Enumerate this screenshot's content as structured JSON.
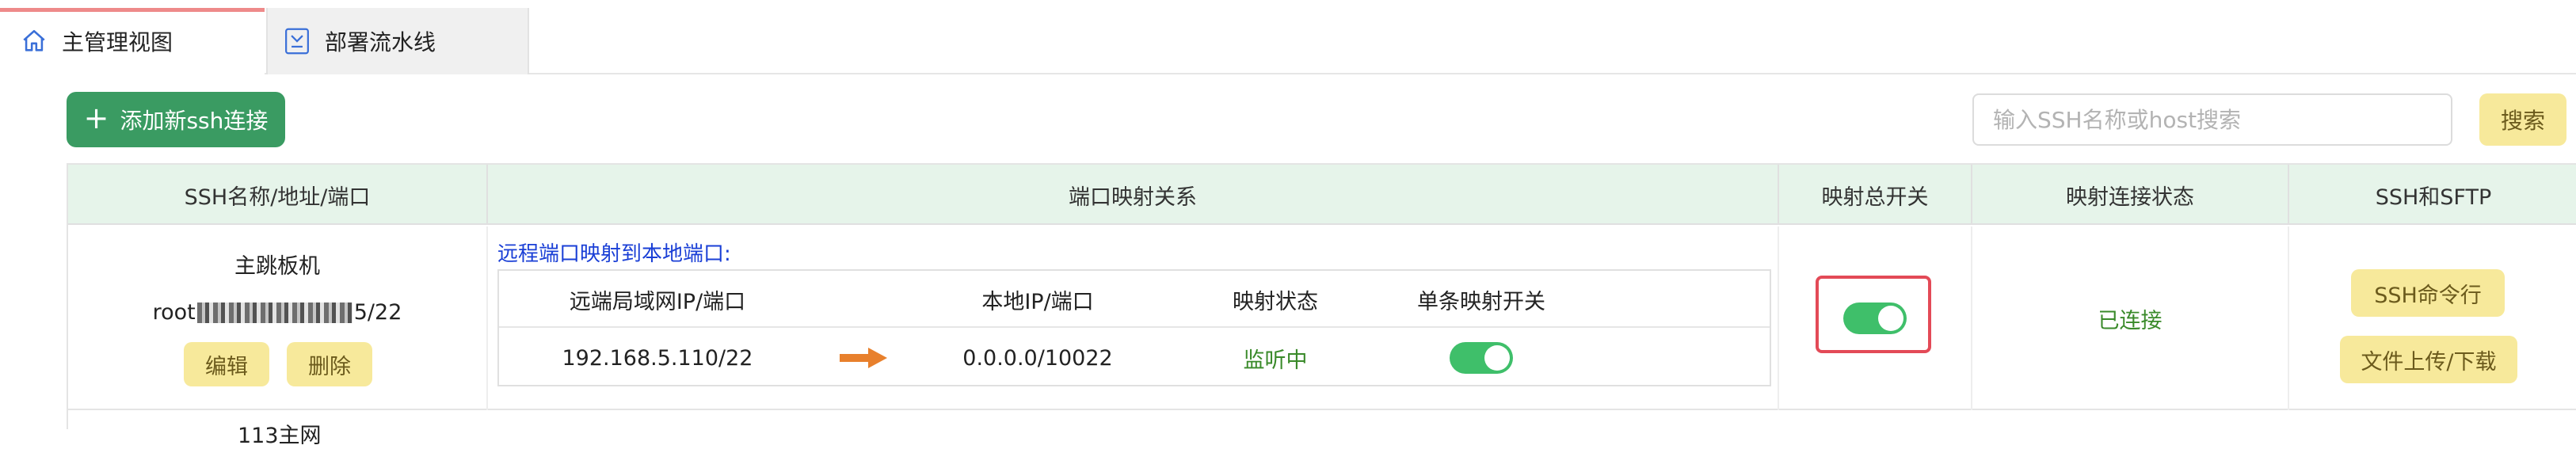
{
  "tabs": [
    {
      "label": "主管理视图",
      "icon": "home-icon",
      "active": true
    },
    {
      "label": "部署流水线",
      "icon": "pipeline-icon",
      "active": false
    }
  ],
  "toolbar": {
    "add_label": "添加新ssh连接",
    "search_placeholder": "输入SSH名称或host搜索",
    "search_label": "搜索"
  },
  "table": {
    "headers": [
      "SSH名称/地址/端口",
      "端口映射关系",
      "映射总开关",
      "映射连接状态",
      "SSH和SFTP"
    ],
    "rows": [
      {
        "name": "主跳板机",
        "addr_prefix": "root",
        "addr_suffix": "5/22",
        "edit_label": "编辑",
        "delete_label": "删除",
        "mapping_title": "远程端口映射到本地端口:",
        "mapping_headers": [
          "远端局域网IP/端口",
          "本地IP/端口",
          "映射状态",
          "单条映射开关"
        ],
        "mappings": [
          {
            "remote": "192.168.5.110/22",
            "local": "0.0.0.0/10022",
            "status": "监听中",
            "enabled": true
          }
        ],
        "master_switch": true,
        "connection_status": "已连接",
        "ssh_cmd_label": "SSH命令行",
        "sftp_label": "文件上传/下载"
      }
    ],
    "next_row_partial": "113主网"
  },
  "colors": {
    "primary_green": "#3a9b62",
    "header_bg": "#e6f4ea",
    "button_yellow": "#f7e99b",
    "toggle_on": "#3fbf6a",
    "status_green": "#3a8a2a",
    "link_blue": "#1a3fd6",
    "highlight_red": "#e34a57",
    "arrow_orange": "#e8802c"
  }
}
